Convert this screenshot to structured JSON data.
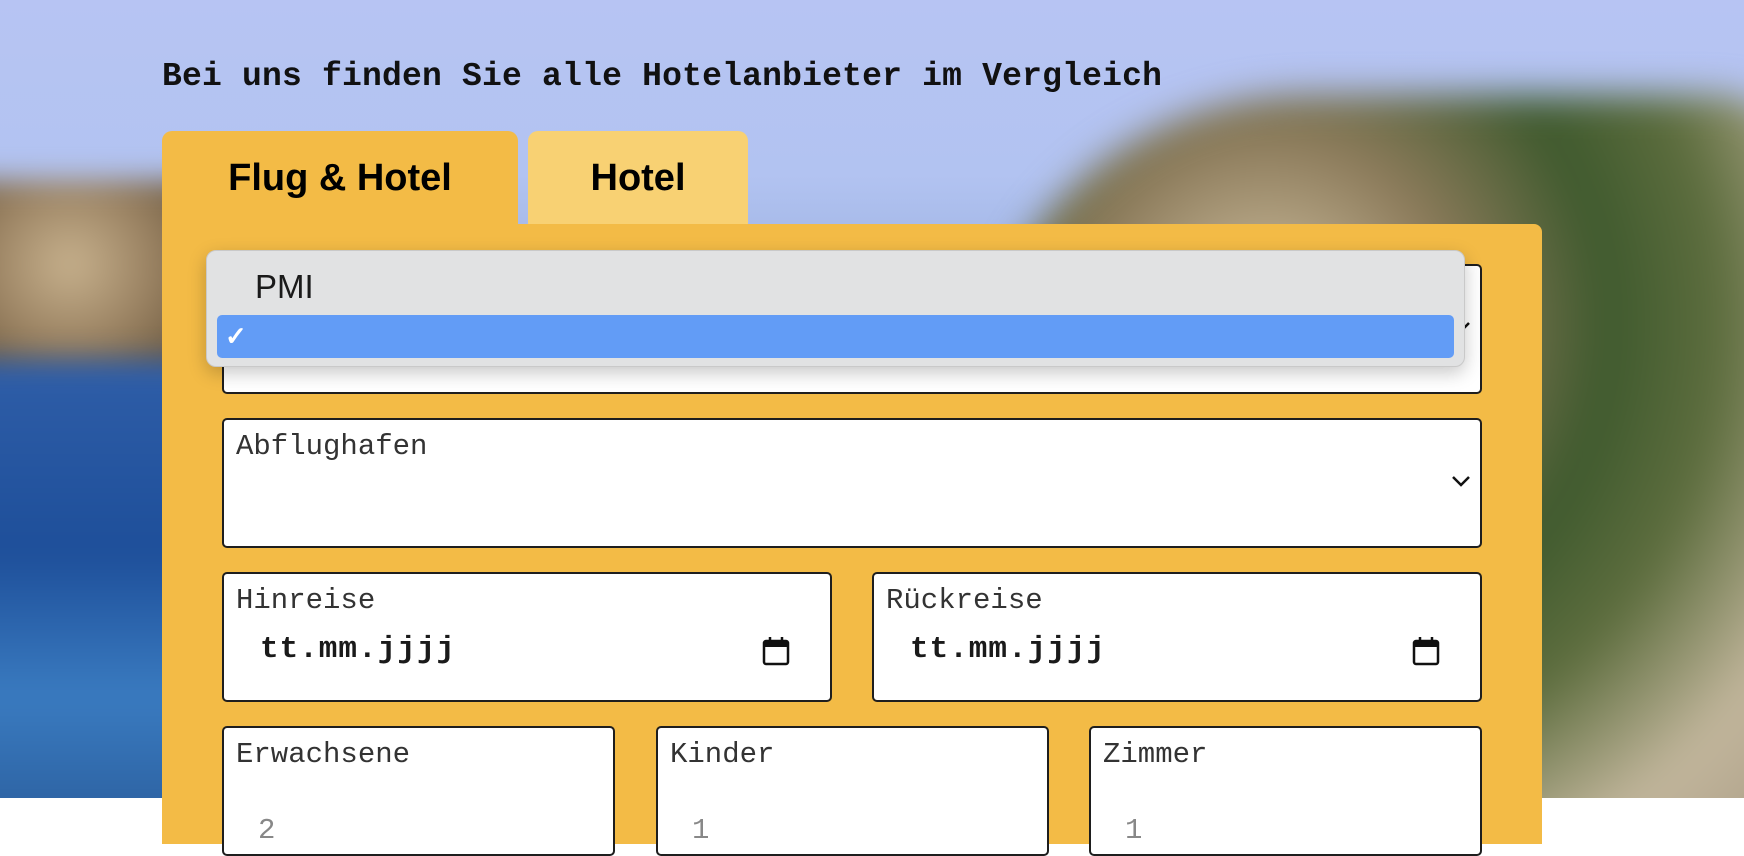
{
  "headline": "Bei uns finden Sie alle Hotelanbieter im Vergleich",
  "tabs": [
    {
      "label": "Flug & Hotel",
      "active": true
    },
    {
      "label": "Hotel",
      "active": false
    }
  ],
  "form": {
    "departure_airport_label": "Abflughafen",
    "outbound_label": "Hinreise",
    "outbound_placeholder": "tt.mm.jjjj",
    "return_label": "Rückreise",
    "return_placeholder": "tt.mm.jjjj",
    "adults_label": "Erwachsene",
    "adults_value": "2",
    "children_label": "Kinder",
    "children_value": "1",
    "rooms_label": "Zimmer",
    "rooms_value": "1"
  },
  "destination_dropdown": {
    "options": [
      "PMI",
      ""
    ],
    "selected_index": 1,
    "check_glyph": "✓"
  },
  "colors": {
    "panel": "#f3bb46",
    "tab_inactive": "#f8d173",
    "selected_option": "#629cf6"
  }
}
